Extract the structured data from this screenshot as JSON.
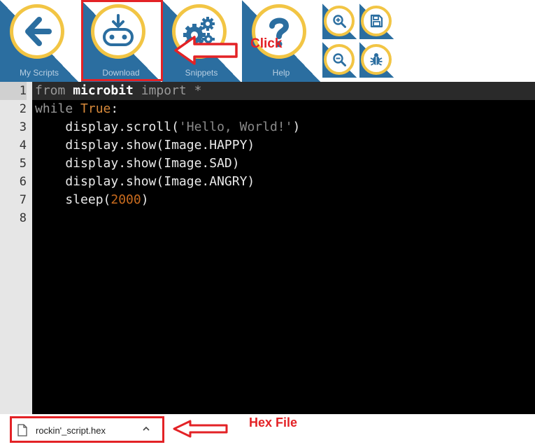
{
  "toolbar": {
    "buttons": [
      {
        "label": "My Scripts",
        "icon": "arrow-left-icon"
      },
      {
        "label": "Download",
        "icon": "microbit-download-icon"
      },
      {
        "label": "Snippets",
        "icon": "gears-icon"
      },
      {
        "label": "Help",
        "icon": "question-icon"
      }
    ],
    "mini_buttons": [
      {
        "icon": "zoom-in-icon"
      },
      {
        "icon": "save-icon"
      },
      {
        "icon": "zoom-out-icon"
      },
      {
        "icon": "bug-icon"
      }
    ],
    "annotation": {
      "text": "Click",
      "color": "#e32226"
    }
  },
  "editor": {
    "active_line": 1,
    "line_numbers": [
      "1",
      "2",
      "3",
      "4",
      "5",
      "6",
      "7",
      "8"
    ],
    "lines": [
      [
        {
          "t": "from ",
          "c": "kw"
        },
        {
          "t": "microbit",
          "c": "mod"
        },
        {
          "t": " import ",
          "c": "kw"
        },
        {
          "t": "*",
          "c": "op"
        }
      ],
      [
        {
          "t": "while ",
          "c": "kw"
        },
        {
          "t": "True",
          "c": "bool"
        },
        {
          "t": ":",
          "c": ""
        }
      ],
      [
        {
          "t": "    display.scroll(",
          "c": ""
        },
        {
          "t": "'Hello, World!'",
          "c": "str"
        },
        {
          "t": ")",
          "c": ""
        }
      ],
      [
        {
          "t": "    display.show(Image.HAPPY)",
          "c": ""
        }
      ],
      [
        {
          "t": "    display.show(Image.SAD)",
          "c": ""
        }
      ],
      [
        {
          "t": "    display.show(Image.ANGRY)",
          "c": ""
        }
      ],
      [
        {
          "t": "    sleep(",
          "c": ""
        },
        {
          "t": "2000",
          "c": "num"
        },
        {
          "t": ")",
          "c": ""
        }
      ],
      []
    ]
  },
  "download_bar": {
    "file_name": "rockin'_script.hex",
    "annotation": {
      "text": "Hex File",
      "color": "#e32226"
    }
  },
  "colors": {
    "tile_blue": "#2b6ea0",
    "ring_yellow": "#f2c544",
    "highlight_red": "#e32226"
  }
}
